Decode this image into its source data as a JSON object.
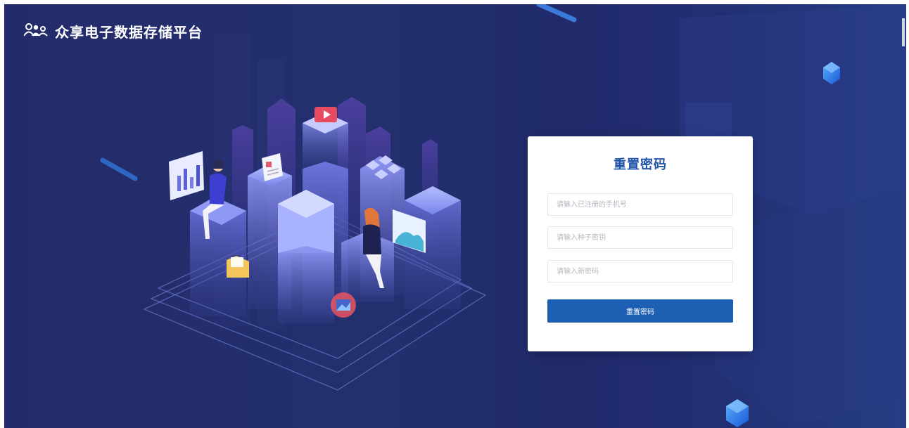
{
  "header": {
    "title": "众享电子数据存储平台",
    "logo_icon": "users-icon"
  },
  "form": {
    "title": "重置密码",
    "phone_placeholder": "请输入已注册的手机号",
    "seed_key_placeholder": "请输入种子密钥",
    "new_password_placeholder": "请输入新密码",
    "submit_label": "重置密码"
  },
  "colors": {
    "background": "#232c6c",
    "accent": "#1d5fb3",
    "title": "#2054a8",
    "panel": "#ffffff"
  }
}
